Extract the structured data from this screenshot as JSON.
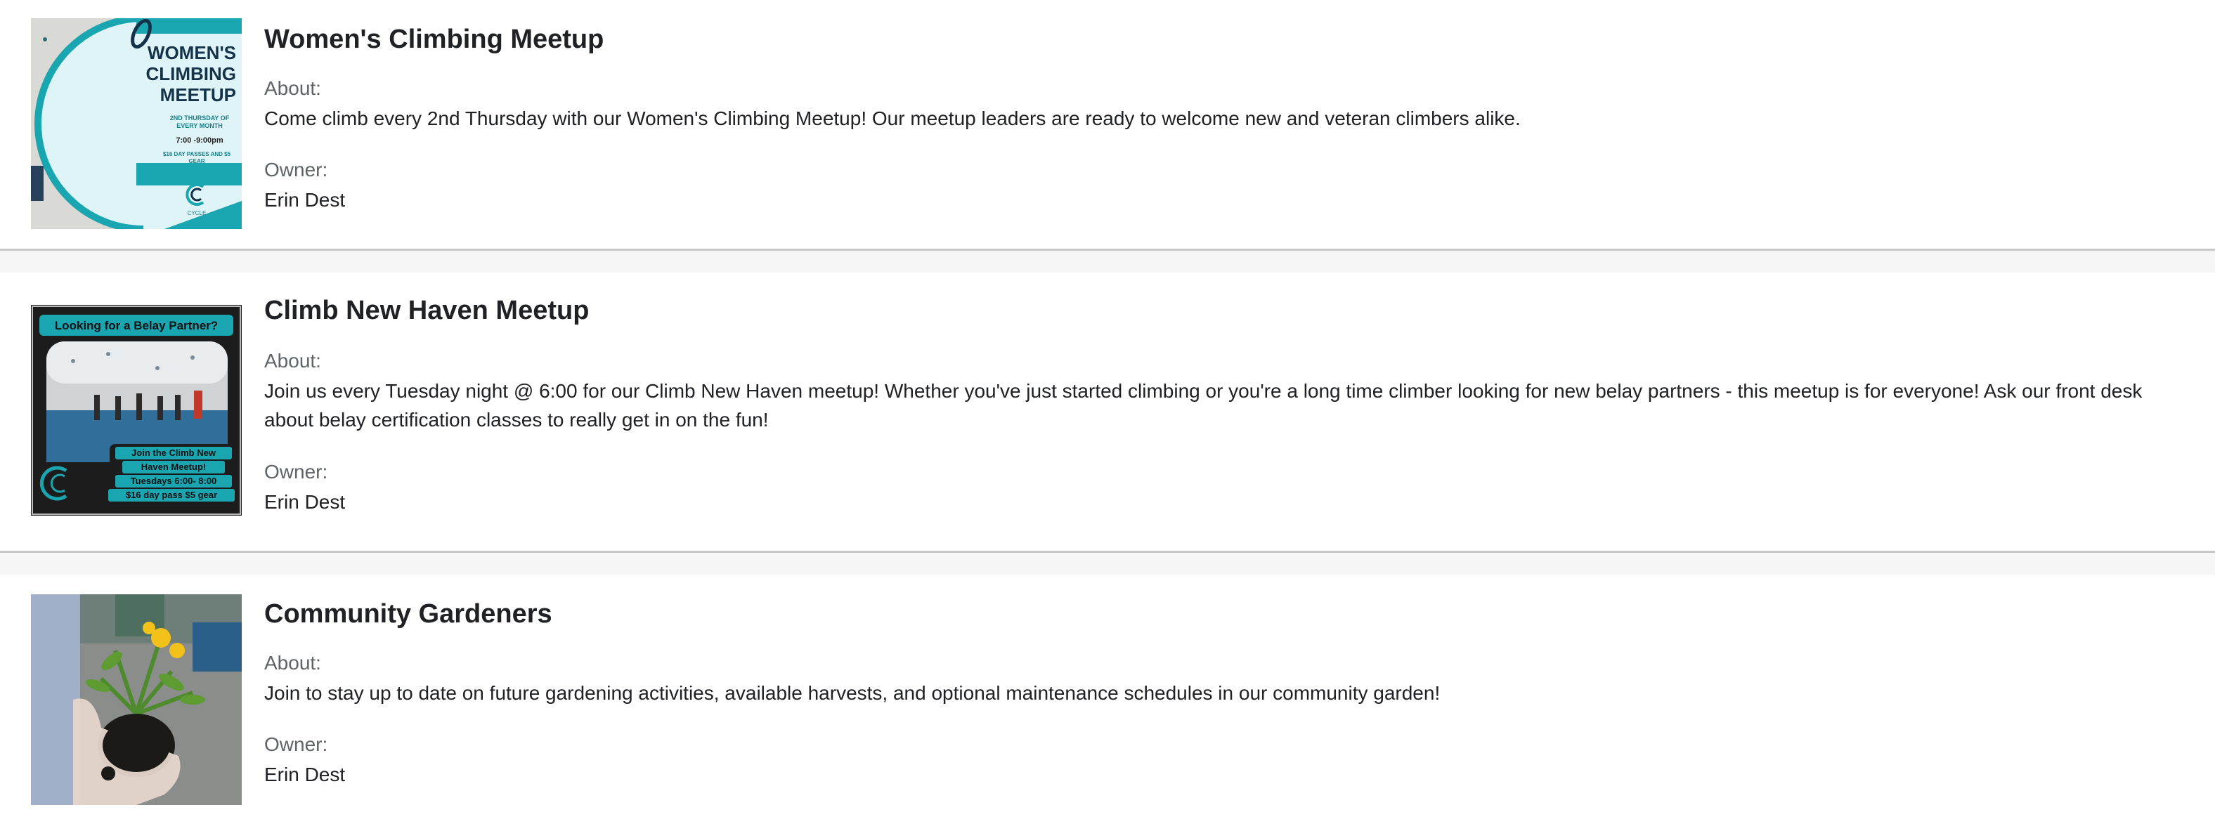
{
  "groups": [
    {
      "title": "Women's Climbing Meetup",
      "about_label": "About:",
      "about": "Come climb every 2nd Thursday with our Women's Climbing Meetup! Our meetup leaders are ready to welcome new and veteran climbers alike.",
      "owner_label": "Owner:",
      "owner": "Erin Dest",
      "image": {
        "title_lines": [
          "WOMEN'S",
          "CLIMBING",
          "MEETUP"
        ],
        "schedule_lines": [
          "2ND THURSDAY OF",
          "EVERY MONTH"
        ],
        "time": "7:00 -9:00pm",
        "price_lines": [
          "$16 DAY PASSES AND $5",
          "GEAR"
        ],
        "brand": "CYCLE"
      }
    },
    {
      "title": "Climb New Haven Meetup",
      "about_label": "About:",
      "about": "Join us every Tuesday night @ 6:00 for our Climb New Haven meetup! Whether you've just started climbing or you're a long time climber looking for new belay partners - this meetup is for everyone! Ask our front desk about belay certification classes to really get in on the fun!",
      "owner_label": "Owner:",
      "owner": "Erin Dest",
      "image": {
        "header": "Looking for a Belay Partner?",
        "lines": [
          "Join the Climb New",
          "Haven Meetup!",
          "Tuesdays 6:00- 8:00",
          "$16 day pass $5 gear"
        ]
      }
    },
    {
      "title": "Community Gardeners",
      "about_label": "About:",
      "about": "Join to stay up to date on future gardening activities, available harvests, and optional maintenance schedules in our community garden!",
      "owner_label": "Owner:",
      "owner": "Erin Dest"
    }
  ],
  "colors": {
    "accent_teal": "#1aa6b0",
    "dark_navy": "#14324a",
    "background": "#f6f6f6"
  }
}
